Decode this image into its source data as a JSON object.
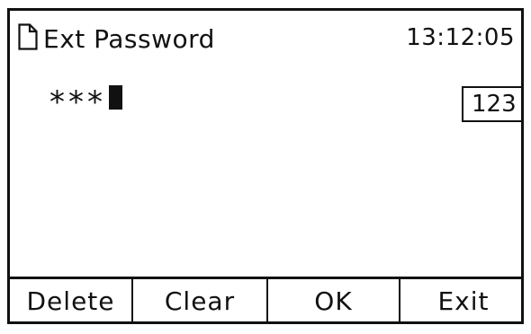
{
  "header": {
    "icon": "document-icon",
    "title": "Ext Password",
    "time": "13:12:05"
  },
  "password": {
    "masked_value": "***",
    "input_mode": "123"
  },
  "softkeys": [
    {
      "label": "Delete"
    },
    {
      "label": "Clear"
    },
    {
      "label": "OK"
    },
    {
      "label": "Exit"
    }
  ]
}
